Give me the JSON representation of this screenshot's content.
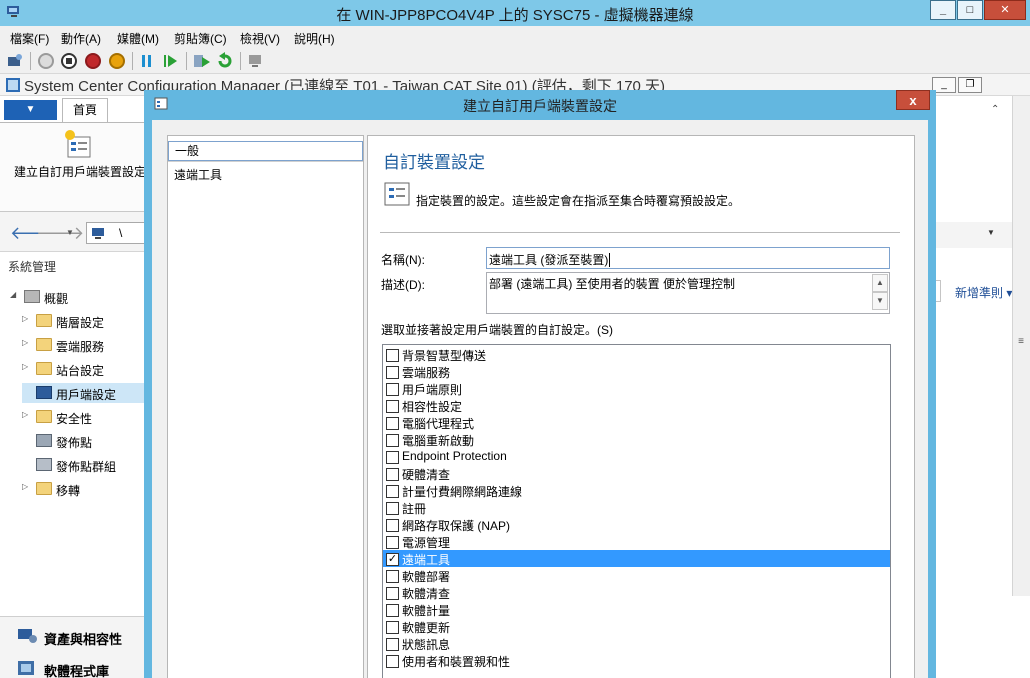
{
  "vm_window": {
    "title": "在 WIN-JPP8PCO4V4P 上的 SYSC75 - 虛擬機器連線",
    "controls": {
      "minimize": "_",
      "maximize": "□",
      "close": "✕"
    }
  },
  "vm_menu": [
    "檔案(F)",
    "動作(A)",
    "媒體(M)",
    "剪貼簿(C)",
    "檢視(V)",
    "說明(H)"
  ],
  "vm_toolbar_icons": [
    "ctrl-alt-del-icon",
    "start-icon",
    "turn-off-icon",
    "shutdown-icon",
    "power-icon",
    "pause-icon",
    "resume-icon",
    "checkpoint-icon",
    "revert-icon",
    "enhanced-session-icon"
  ],
  "console": {
    "title": "System Center Configuration Manager (已連線至 T01 - Taiwan CAT Site 01) (評估，剩下 170 天)",
    "ribbon_tab": "首頁",
    "ribbon_button": "建立自訂用戶端裝置設定",
    "nav_path": "\\",
    "tree_header": "系統管理",
    "tree": [
      {
        "label": "概觀",
        "icon": "overview-icon"
      },
      {
        "label": "階層設定",
        "icon": "folder-icon"
      },
      {
        "label": "雲端服務",
        "icon": "folder-icon"
      },
      {
        "label": "站台設定",
        "icon": "folder-icon"
      },
      {
        "label": "用戶端設定",
        "icon": "client-settings-icon"
      },
      {
        "label": "安全性",
        "icon": "folder-icon"
      },
      {
        "label": "發佈點",
        "icon": "distribution-point-icon"
      },
      {
        "label": "發佈點群組",
        "icon": "distribution-group-icon"
      },
      {
        "label": "移轉",
        "icon": "folder-icon"
      }
    ],
    "wunderbar": [
      "資產與相容性",
      "軟體程式庫"
    ],
    "right_link": "新增準則"
  },
  "dialog": {
    "title": "建立自訂用戶端裝置設定",
    "close": "x",
    "nav": [
      "一般",
      "遠端工具"
    ],
    "heading": "自訂裝置設定",
    "description": "指定裝置的設定。這些設定會在指派至集合時覆寫預設設定。",
    "name_label": "名稱(N):",
    "name_value": "遠端工具 (發派至裝置)",
    "desc_label": "描述(D):",
    "desc_value": "部署 (遠端工具) 至使用者的裝置 便於管理控制",
    "list_label": "選取並接著設定用戶端裝置的自訂設定。(S)",
    "settings": [
      {
        "label": "背景智慧型傳送",
        "checked": false
      },
      {
        "label": "雲端服務",
        "checked": false
      },
      {
        "label": "用戶端原則",
        "checked": false
      },
      {
        "label": "相容性設定",
        "checked": false
      },
      {
        "label": "電腦代理程式",
        "checked": false
      },
      {
        "label": "電腦重新啟動",
        "checked": false
      },
      {
        "label": "Endpoint Protection",
        "checked": false
      },
      {
        "label": "硬體清查",
        "checked": false
      },
      {
        "label": "計量付費網際網路連線",
        "checked": false
      },
      {
        "label": "註冊",
        "checked": false
      },
      {
        "label": "網路存取保護 (NAP)",
        "checked": false
      },
      {
        "label": "電源管理",
        "checked": false
      },
      {
        "label": "遠端工具",
        "checked": true,
        "selected": true
      },
      {
        "label": "軟體部署",
        "checked": false
      },
      {
        "label": "軟體清查",
        "checked": false
      },
      {
        "label": "軟體計量",
        "checked": false
      },
      {
        "label": "軟體更新",
        "checked": false
      },
      {
        "label": "狀態訊息",
        "checked": false
      },
      {
        "label": "使用者和裝置親和性",
        "checked": false
      }
    ]
  }
}
